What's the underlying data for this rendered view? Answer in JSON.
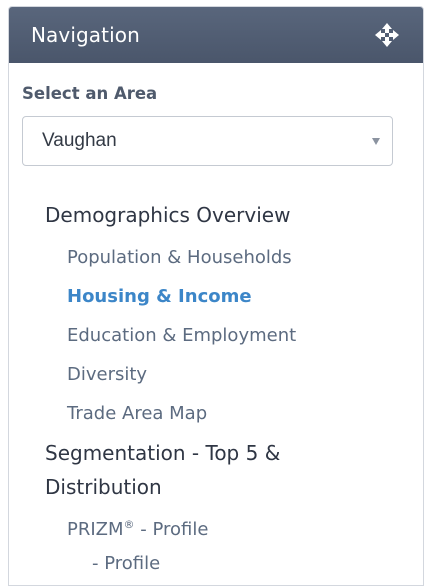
{
  "header": {
    "title": "Navigation",
    "move_icon": "move-arrows-icon"
  },
  "area": {
    "label": "Select an Area",
    "selected": "Vaughan"
  },
  "nav": {
    "demographics": {
      "label": "Demographics Overview",
      "items": [
        {
          "label": "Population & Households",
          "active": false
        },
        {
          "label": "Housing & Income",
          "active": true
        },
        {
          "label": "Education & Employment",
          "active": false
        },
        {
          "label": "Diversity",
          "active": false
        },
        {
          "label": "Trade Area Map",
          "active": false
        }
      ]
    },
    "segmentation": {
      "label_line1": "Segmentation - Top 5 &",
      "label_line2": "Distribution",
      "prizm_name": "PRIZM",
      "prizm_reg": "®",
      "prizm_suffix": " - Profile",
      "sub_profile": "- Profile"
    }
  },
  "colors": {
    "header_bg": "#4f5b70",
    "active_link": "#3c86c8",
    "link": "#5c6b80"
  }
}
